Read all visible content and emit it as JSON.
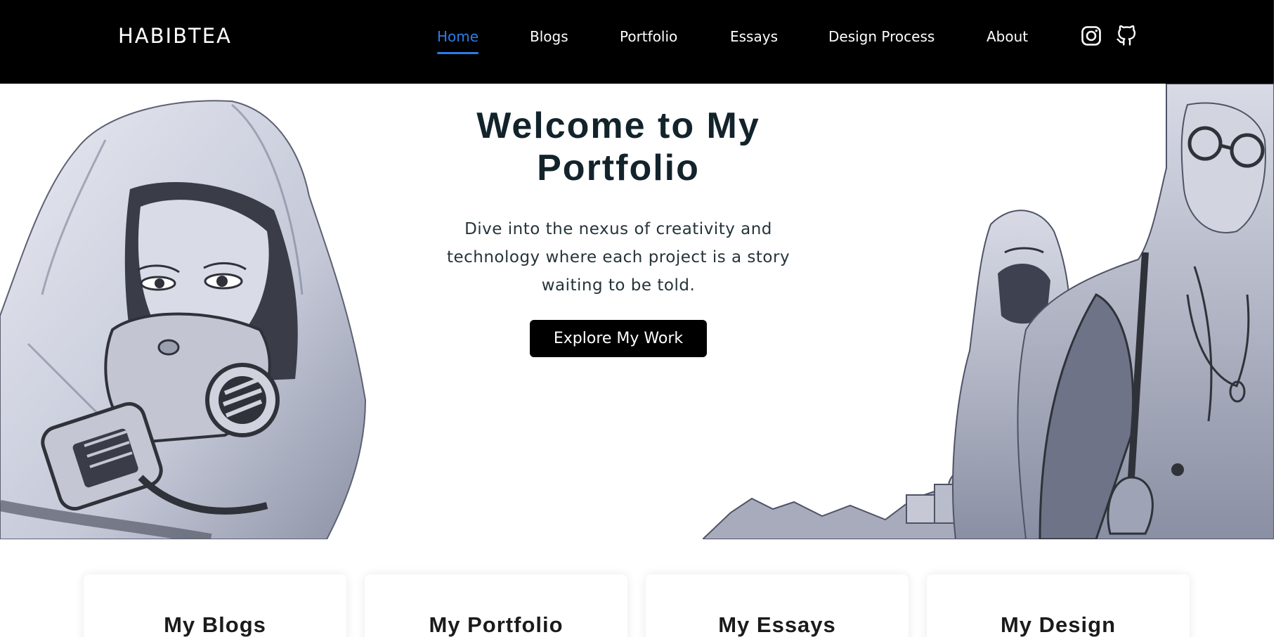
{
  "brand": {
    "name": "HABIBTEA"
  },
  "nav": {
    "items": [
      {
        "label": "Home",
        "active": true
      },
      {
        "label": "Blogs",
        "active": false
      },
      {
        "label": "Portfolio",
        "active": false
      },
      {
        "label": "Essays",
        "active": false
      },
      {
        "label": "Design Process",
        "active": false
      },
      {
        "label": "About",
        "active": false
      }
    ],
    "social": [
      "instagram-icon",
      "github-icon"
    ]
  },
  "hero": {
    "title": "Welcome to My Portfolio",
    "subtitle": "Dive into the nexus of creativity and technology where each project is a story waiting to be told.",
    "button_label": "Explore My Work"
  },
  "cards": [
    {
      "title": "My Blogs"
    },
    {
      "title": "My Portfolio"
    },
    {
      "title": "My Essays"
    },
    {
      "title": "My Design"
    }
  ],
  "colors": {
    "nav_background": "#000000",
    "nav_active": "#2b7de9",
    "heading": "#12232b",
    "button": "#000000"
  }
}
